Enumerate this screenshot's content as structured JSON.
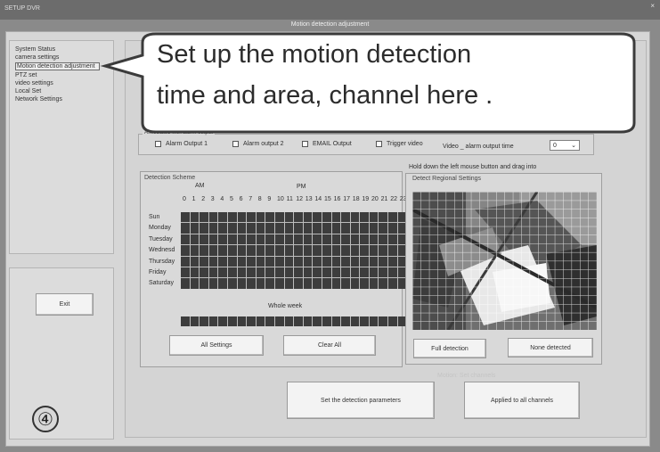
{
  "window": {
    "breadcrumb": "SETUP   DVR",
    "title": "Motion detection adjustment",
    "close_glyph": "×"
  },
  "sidebar": {
    "items": [
      {
        "label": "System Status"
      },
      {
        "label": "camera settings"
      },
      {
        "label": "Motion detection adjustment"
      },
      {
        "label": "PTZ set"
      },
      {
        "label": "video settings"
      },
      {
        "label": "Local Set"
      },
      {
        "label": "Network Settings"
      }
    ],
    "active_index": 2,
    "exit_label": "Exit"
  },
  "step_marker": "④",
  "callout": {
    "line1": "Set up the motion detection",
    "line2": "time and area, channel here ."
  },
  "alarm_linkage": {
    "title": "Associated with alarm output",
    "options": [
      {
        "label": "Alarm Output 1",
        "checked": false
      },
      {
        "label": "Alarm output 2",
        "checked": false
      },
      {
        "label": "EMAIL Output",
        "checked": false
      },
      {
        "label": "Trigger video",
        "checked": false
      }
    ],
    "duration_label": "Video _ alarm output time",
    "duration_value": "0"
  },
  "schedule": {
    "title": "Detection Scheme",
    "am_label": "AM",
    "pm_label": "PM",
    "hours": [
      "0",
      "1",
      "2",
      "3",
      "4",
      "5",
      "6",
      "7",
      "8",
      "9",
      "10",
      "11",
      "12",
      "13",
      "14",
      "15",
      "16",
      "17",
      "18",
      "19",
      "20",
      "21",
      "22",
      "23"
    ],
    "days": [
      "Sun",
      "Monday",
      "Tuesday",
      "Wednesd",
      "Thursday",
      "Friday",
      "Saturday"
    ],
    "whole_week_label": "Whole week",
    "all_settings_label": "All Settings",
    "clear_all_label": "Clear All"
  },
  "region": {
    "hint": "Hold down the left mouse button and drag into",
    "title": "Detect Regional Settings",
    "full_detection_label": "Full detection",
    "none_detected_label": "None detected"
  },
  "actions": {
    "faded_text": "Motion: Set channels",
    "set_params_label": "Set the detection parameters",
    "apply_all_label": "Applied to all channels"
  }
}
